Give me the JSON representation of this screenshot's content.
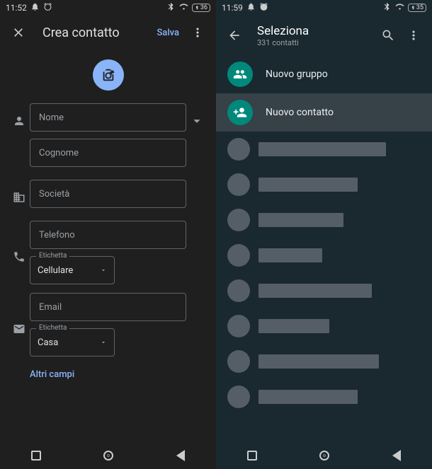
{
  "left": {
    "status_time": "11:52",
    "battery": "36",
    "title": "Crea contatto",
    "save": "Salva",
    "fields": {
      "name": "Nome",
      "surname": "Cognome",
      "company": "Società",
      "phone": "Telefono",
      "phone_label_caption": "Etichetta",
      "phone_label_value": "Cellulare",
      "email": "Email",
      "email_label_caption": "Etichetta",
      "email_label_value": "Casa"
    },
    "more": "Altri campi"
  },
  "right": {
    "status_time": "11:59",
    "battery": "35",
    "title": "Seleziona",
    "subtitle": "331 contatti",
    "actions": {
      "group": "Nuovo gruppo",
      "contact": "Nuovo contatto"
    },
    "contact_placeholders": [
      180,
      140,
      120,
      90,
      160,
      100,
      170,
      140
    ]
  }
}
